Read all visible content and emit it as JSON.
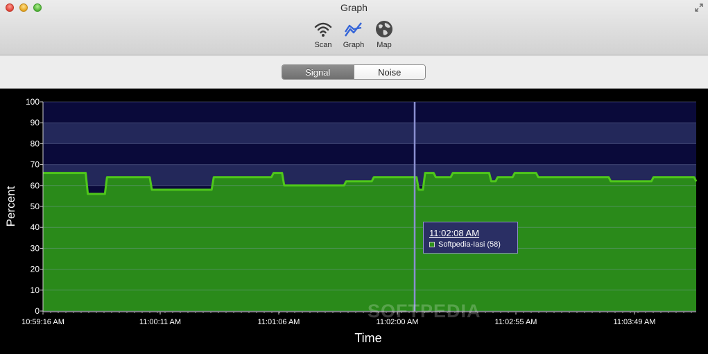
{
  "window": {
    "title": "Graph"
  },
  "toolbar": {
    "items": [
      {
        "label": "Scan",
        "icon": "wifi-icon"
      },
      {
        "label": "Graph",
        "icon": "graph-icon"
      },
      {
        "label": "Map",
        "icon": "globe-icon"
      }
    ]
  },
  "segments": {
    "items": [
      "Signal",
      "Noise"
    ],
    "selected": "Signal"
  },
  "tooltip": {
    "time": "11:02:08 AM",
    "entry": "Softpedia-Iasi (58)",
    "color": "#2d8f1c"
  },
  "watermark": "SOFTPEDIA",
  "colors": {
    "accent": "#3565d8",
    "series_fill": "#2a8a1a",
    "series_line": "#4fc81a",
    "plot_bg_dark": "#0a0a3a",
    "plot_bg_light": "#23285a",
    "cursor": "#8a8fd0"
  },
  "chart_data": {
    "type": "area",
    "title": "",
    "xlabel": "Time",
    "ylabel": "Percent",
    "ylim": [
      0,
      100
    ],
    "yticks": [
      0,
      10,
      20,
      30,
      40,
      50,
      60,
      70,
      80,
      90,
      100
    ],
    "xticks": [
      "10:59:16 AM",
      "11:00:11 AM",
      "11:01:06 AM",
      "11:02:00 AM",
      "11:02:55 AM",
      "11:03:49 AM"
    ],
    "grid": true,
    "cursor_time": "11:02:08 AM",
    "series": [
      {
        "name": "Softpedia-Iasi",
        "t": [
          0,
          20,
          21,
          29,
          30,
          50,
          51,
          79,
          80,
          107,
          108,
          112,
          113,
          141,
          142,
          154,
          155,
          175,
          176,
          178,
          179,
          183,
          184,
          191,
          192,
          209,
          210,
          212,
          213,
          220,
          221,
          231,
          232,
          265,
          266,
          285,
          286,
          305,
          306
        ],
        "values": [
          66,
          66,
          56,
          56,
          64,
          64,
          58,
          58,
          64,
          64,
          66,
          66,
          60,
          60,
          62,
          62,
          64,
          64,
          58,
          58,
          66,
          66,
          64,
          64,
          66,
          66,
          62,
          62,
          64,
          64,
          66,
          66,
          64,
          64,
          62,
          62,
          64,
          64,
          62
        ]
      }
    ]
  }
}
